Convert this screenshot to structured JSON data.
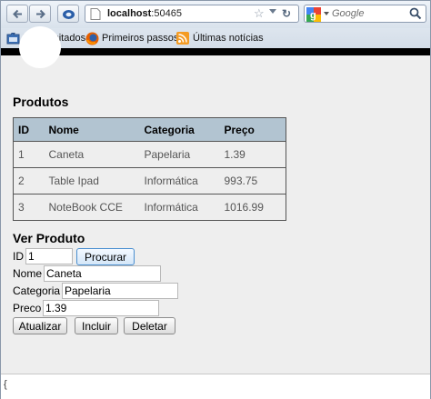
{
  "browser": {
    "url_host": "localhost",
    "url_port": ":50465",
    "search_placeholder": "Google",
    "bookmarks": [
      "Mais visitados",
      "Primeiros passos",
      "Últimas notícias"
    ]
  },
  "page": {
    "title": "Produtos",
    "table": {
      "headers": [
        "ID",
        "Nome",
        "Categoria",
        "Preço"
      ],
      "rows": [
        [
          "1",
          "Caneta",
          "Papelaria",
          "1.39"
        ],
        [
          "2",
          "Table Ipad",
          "Informática",
          "993.75"
        ],
        [
          "3",
          "NoteBook CCE",
          "Informática",
          "1016.99"
        ]
      ]
    },
    "form": {
      "title": "Ver Produto",
      "id_label": "ID",
      "id_value": "1",
      "search_button": "Procurar",
      "nome_label": "Nome",
      "nome_value": "Caneta",
      "categoria_label": "Categoria",
      "categoria_value": "Papelaria",
      "preco_label": "Preco",
      "preco_value": "1.39",
      "buttons": [
        "Atualizar",
        "Incluir",
        "Deletar"
      ]
    }
  },
  "status": {
    "text": "{"
  },
  "colors": {
    "table_header": "#b2c4d1",
    "page_background": "#eeeeee",
    "chrome_background": "#dfe6ee"
  }
}
